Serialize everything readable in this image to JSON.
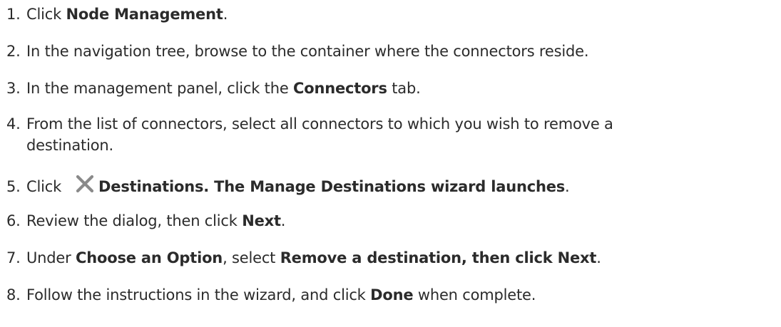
{
  "steps": [
    {
      "num": "1.",
      "text_a": "Click ",
      "bold_a": "Node Management",
      "text_b": "."
    },
    {
      "num": "2.",
      "text_a": "In the navigation tree, browse to the container where the connectors reside."
    },
    {
      "num": "3.",
      "text_a": "In the management panel, click the ",
      "bold_a": "Connectors",
      "text_b": " tab."
    },
    {
      "num": "4.",
      "text_a": "From the list of connectors, select all connectors to which you wish to remove a",
      "text_b": "destination."
    },
    {
      "num": "5.",
      "text_a": "Click",
      "icon": "close-x-icon",
      "bold_a": "Destinations. The Manage Destinations wizard launches",
      "text_b": "."
    },
    {
      "num": "6.",
      "text_a": "Review the dialog, then click ",
      "bold_a": "Next",
      "text_b": "."
    },
    {
      "num": "7.",
      "text_a": "Under ",
      "bold_a": "Choose an Option",
      "text_b": ", select ",
      "bold_b": "Remove a destination, then click Next",
      "text_c": "."
    },
    {
      "num": "8.",
      "text_a": "Follow the instructions in the wizard, and click ",
      "bold_a": "Done",
      "text_b": " when complete."
    }
  ],
  "colors": {
    "text": "#2b2b2b",
    "icon": "#8a8a8a"
  }
}
